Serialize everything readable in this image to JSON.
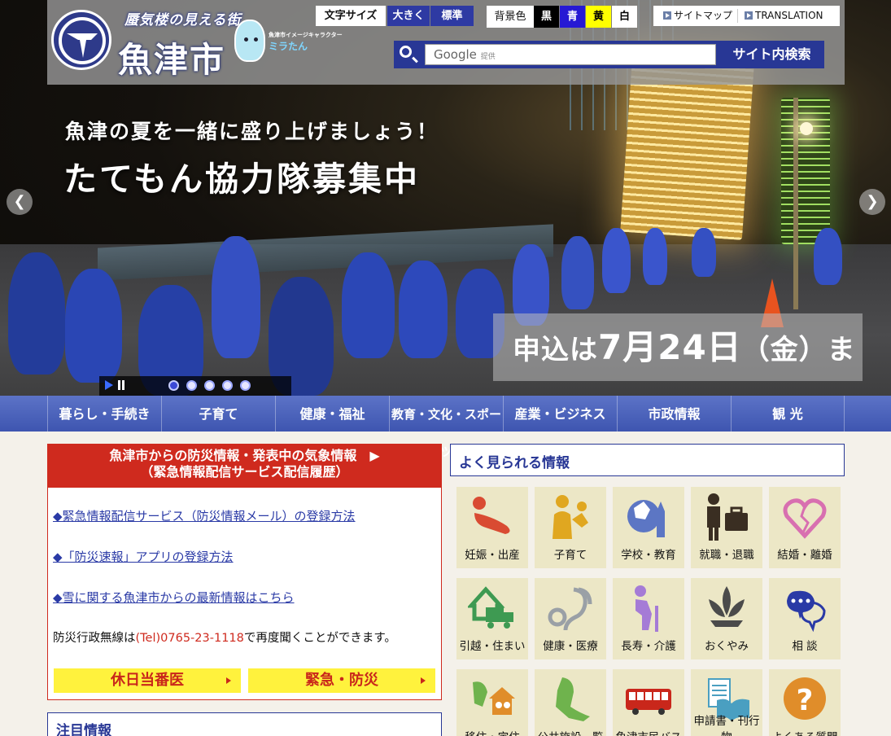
{
  "header": {
    "catchphrase": "蜃気楼の見える街",
    "city_name": "魚津市",
    "mascot_caption": "魚津市イメージキャラクター",
    "mascot_name": "ミラたん",
    "font_size": {
      "label": "文字サイズ",
      "larger": "大きく",
      "standard": "標準"
    },
    "background": {
      "label": "背景色",
      "black": "黒",
      "blue": "青",
      "yellow": "黄",
      "white": "白"
    },
    "links": {
      "sitemap": "サイトマップ",
      "translation": "TRANSLATION"
    },
    "search": {
      "google_label": "Google",
      "provided": "提供",
      "button": "サイト内検索"
    }
  },
  "hero": {
    "subtitle": "魚津の夏を一緒に盛り上げましょう！",
    "title": "たてもん協力隊募集中",
    "deadline_prefix": "申込は",
    "deadline_date": "7月24日",
    "deadline_suffix": "（金）まで",
    "slide_count": 5,
    "active_slide": 1
  },
  "nav": {
    "items": [
      "暮らし・手続き",
      "子育て",
      "健康・福祉",
      "教育・文化・スポーツ",
      "産業・ビジネス",
      "市政情報",
      "観 光"
    ]
  },
  "disaster": {
    "heading_line1": "魚津市からの防災情報・発表中の気象情報　▶",
    "heading_line2": "（緊急情報配信サービス配信履歴）",
    "links": [
      "◆緊急情報配信サービス（防災情報メール）の登録方法",
      "◆「防災速報」アプリの登録方法",
      "◆雪に関する魚津市からの最新情報はこちら"
    ],
    "note_prefix": "防災行政無線は",
    "note_tel": "(Tel)0765-23-1118",
    "note_suffix": "で再度聞くことができます。",
    "button_holiday": "休日当番医",
    "button_emergency": "緊急・防災"
  },
  "notice": {
    "heading": "注目情報"
  },
  "frequent": {
    "heading": "よく見られる情報",
    "tiles": [
      {
        "label": "妊娠・出産",
        "icon": "pregnancy-icon"
      },
      {
        "label": "子育て",
        "icon": "childcare-icon"
      },
      {
        "label": "学校・教育",
        "icon": "school-icon"
      },
      {
        "label": "就職・退職",
        "icon": "employment-icon"
      },
      {
        "label": "結婚・離婚",
        "icon": "marriage-icon"
      },
      {
        "label": "引越・住まい",
        "icon": "moving-icon"
      },
      {
        "label": "健康・医療",
        "icon": "stethoscope-icon"
      },
      {
        "label": "長寿・介護",
        "icon": "elderly-icon"
      },
      {
        "label": "おくやみ",
        "icon": "lotus-icon"
      },
      {
        "label": "相 談",
        "icon": "consultation-icon"
      },
      {
        "label": "移住・定住",
        "icon": "relocation-icon"
      },
      {
        "label": "公共施設一覧",
        "icon": "facilities-icon"
      },
      {
        "label": "魚津市民バス",
        "icon": "bus-icon"
      },
      {
        "label": "申請書・刊行物",
        "icon": "documents-icon"
      },
      {
        "label": "よくある質問",
        "icon": "faq-icon"
      }
    ]
  },
  "colors": {
    "brand_blue": "#283795",
    "alert_red": "#cf2a1e",
    "tile_bg": "#ece7c6",
    "accent_yellow": "#fff23d"
  }
}
